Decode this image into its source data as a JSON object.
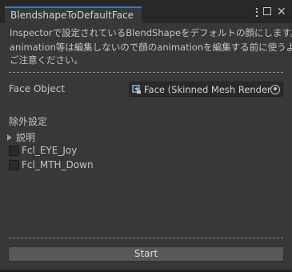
{
  "window": {
    "tab_title": "BlendshapeToDefaultFace",
    "menu_icon": "kebab-menu-icon",
    "maximize_icon": "maximize-icon",
    "close_icon": "close-icon"
  },
  "description": {
    "line1": "Inspectorで設定されているBlendShapeをデフォルトの顔にします。",
    "line2": "animation等は編集しないので顔のanimationを編集する前に使うよう",
    "line3": "ご注意ください。"
  },
  "face_object": {
    "label": "Face Object",
    "value": "Face (Skinned Mesh Renderer)",
    "value_icon": "skinned-mesh-renderer-icon",
    "picker_icon": "object-picker-icon"
  },
  "exclusions": {
    "header": "除外設定",
    "foldout_label": "説明",
    "items": [
      {
        "label": "Fcl_EYE_Joy",
        "checked": false
      },
      {
        "label": "Fcl_MTH_Down",
        "checked": false
      }
    ]
  },
  "start_button": {
    "label": "Start"
  },
  "colors": {
    "background": "#383838",
    "tab_accent": "#3a79bb",
    "button": "#585858"
  }
}
